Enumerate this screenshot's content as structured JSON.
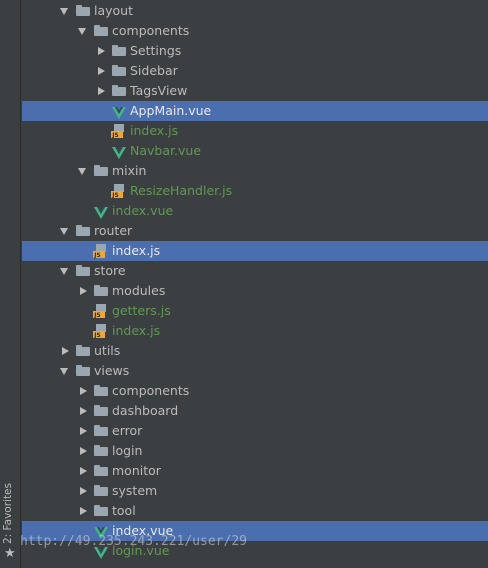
{
  "favorites_label": "2: Favorites",
  "overlay_url": "http://49.235.243.221/user/29",
  "colors": {
    "background": "#3c3f41",
    "selection": "#4b6eaf",
    "text": "#bbbbbb",
    "vcs_new": "#629755",
    "vue_green": "#41b883",
    "js_orange": "#f0a732"
  },
  "tree": [
    {
      "label": "layout",
      "type": "folder",
      "expanded": true,
      "depth": 2
    },
    {
      "label": "components",
      "type": "folder",
      "expanded": true,
      "depth": 3
    },
    {
      "label": "Settings",
      "type": "folder",
      "expanded": false,
      "depth": 4
    },
    {
      "label": "Sidebar",
      "type": "folder",
      "expanded": false,
      "depth": 4
    },
    {
      "label": "TagsView",
      "type": "folder",
      "expanded": false,
      "depth": 4
    },
    {
      "label": "AppMain.vue",
      "type": "vue",
      "depth": 4,
      "selected": true
    },
    {
      "label": "index.js",
      "type": "js",
      "depth": 4,
      "vcs": "new"
    },
    {
      "label": "Navbar.vue",
      "type": "vue",
      "depth": 4,
      "vcs": "new"
    },
    {
      "label": "mixin",
      "type": "folder",
      "expanded": true,
      "depth": 3
    },
    {
      "label": "ResizeHandler.js",
      "type": "js",
      "depth": 4,
      "vcs": "new"
    },
    {
      "label": "index.vue",
      "type": "vue",
      "depth": 3,
      "vcs": "new"
    },
    {
      "label": "router",
      "type": "folder",
      "expanded": true,
      "depth": 2
    },
    {
      "label": "index.js",
      "type": "js",
      "depth": 3,
      "selected": true
    },
    {
      "label": "store",
      "type": "folder",
      "expanded": true,
      "depth": 2
    },
    {
      "label": "modules",
      "type": "folder",
      "expanded": false,
      "depth": 3
    },
    {
      "label": "getters.js",
      "type": "js",
      "depth": 3,
      "vcs": "new"
    },
    {
      "label": "index.js",
      "type": "js",
      "depth": 3,
      "vcs": "new"
    },
    {
      "label": "utils",
      "type": "folder",
      "expanded": false,
      "depth": 2
    },
    {
      "label": "views",
      "type": "folder",
      "expanded": true,
      "depth": 2
    },
    {
      "label": "components",
      "type": "folder",
      "expanded": false,
      "depth": 3
    },
    {
      "label": "dashboard",
      "type": "folder",
      "expanded": false,
      "depth": 3
    },
    {
      "label": "error",
      "type": "folder",
      "expanded": false,
      "depth": 3
    },
    {
      "label": "login",
      "type": "folder",
      "expanded": false,
      "depth": 3
    },
    {
      "label": "monitor",
      "type": "folder",
      "expanded": false,
      "depth": 3
    },
    {
      "label": "system",
      "type": "folder",
      "expanded": false,
      "depth": 3
    },
    {
      "label": "tool",
      "type": "folder",
      "expanded": false,
      "depth": 3
    },
    {
      "label": "index.vue",
      "type": "vue",
      "depth": 3,
      "selected": true
    },
    {
      "label": "login.vue",
      "type": "vue",
      "depth": 3,
      "vcs": "new"
    }
  ]
}
